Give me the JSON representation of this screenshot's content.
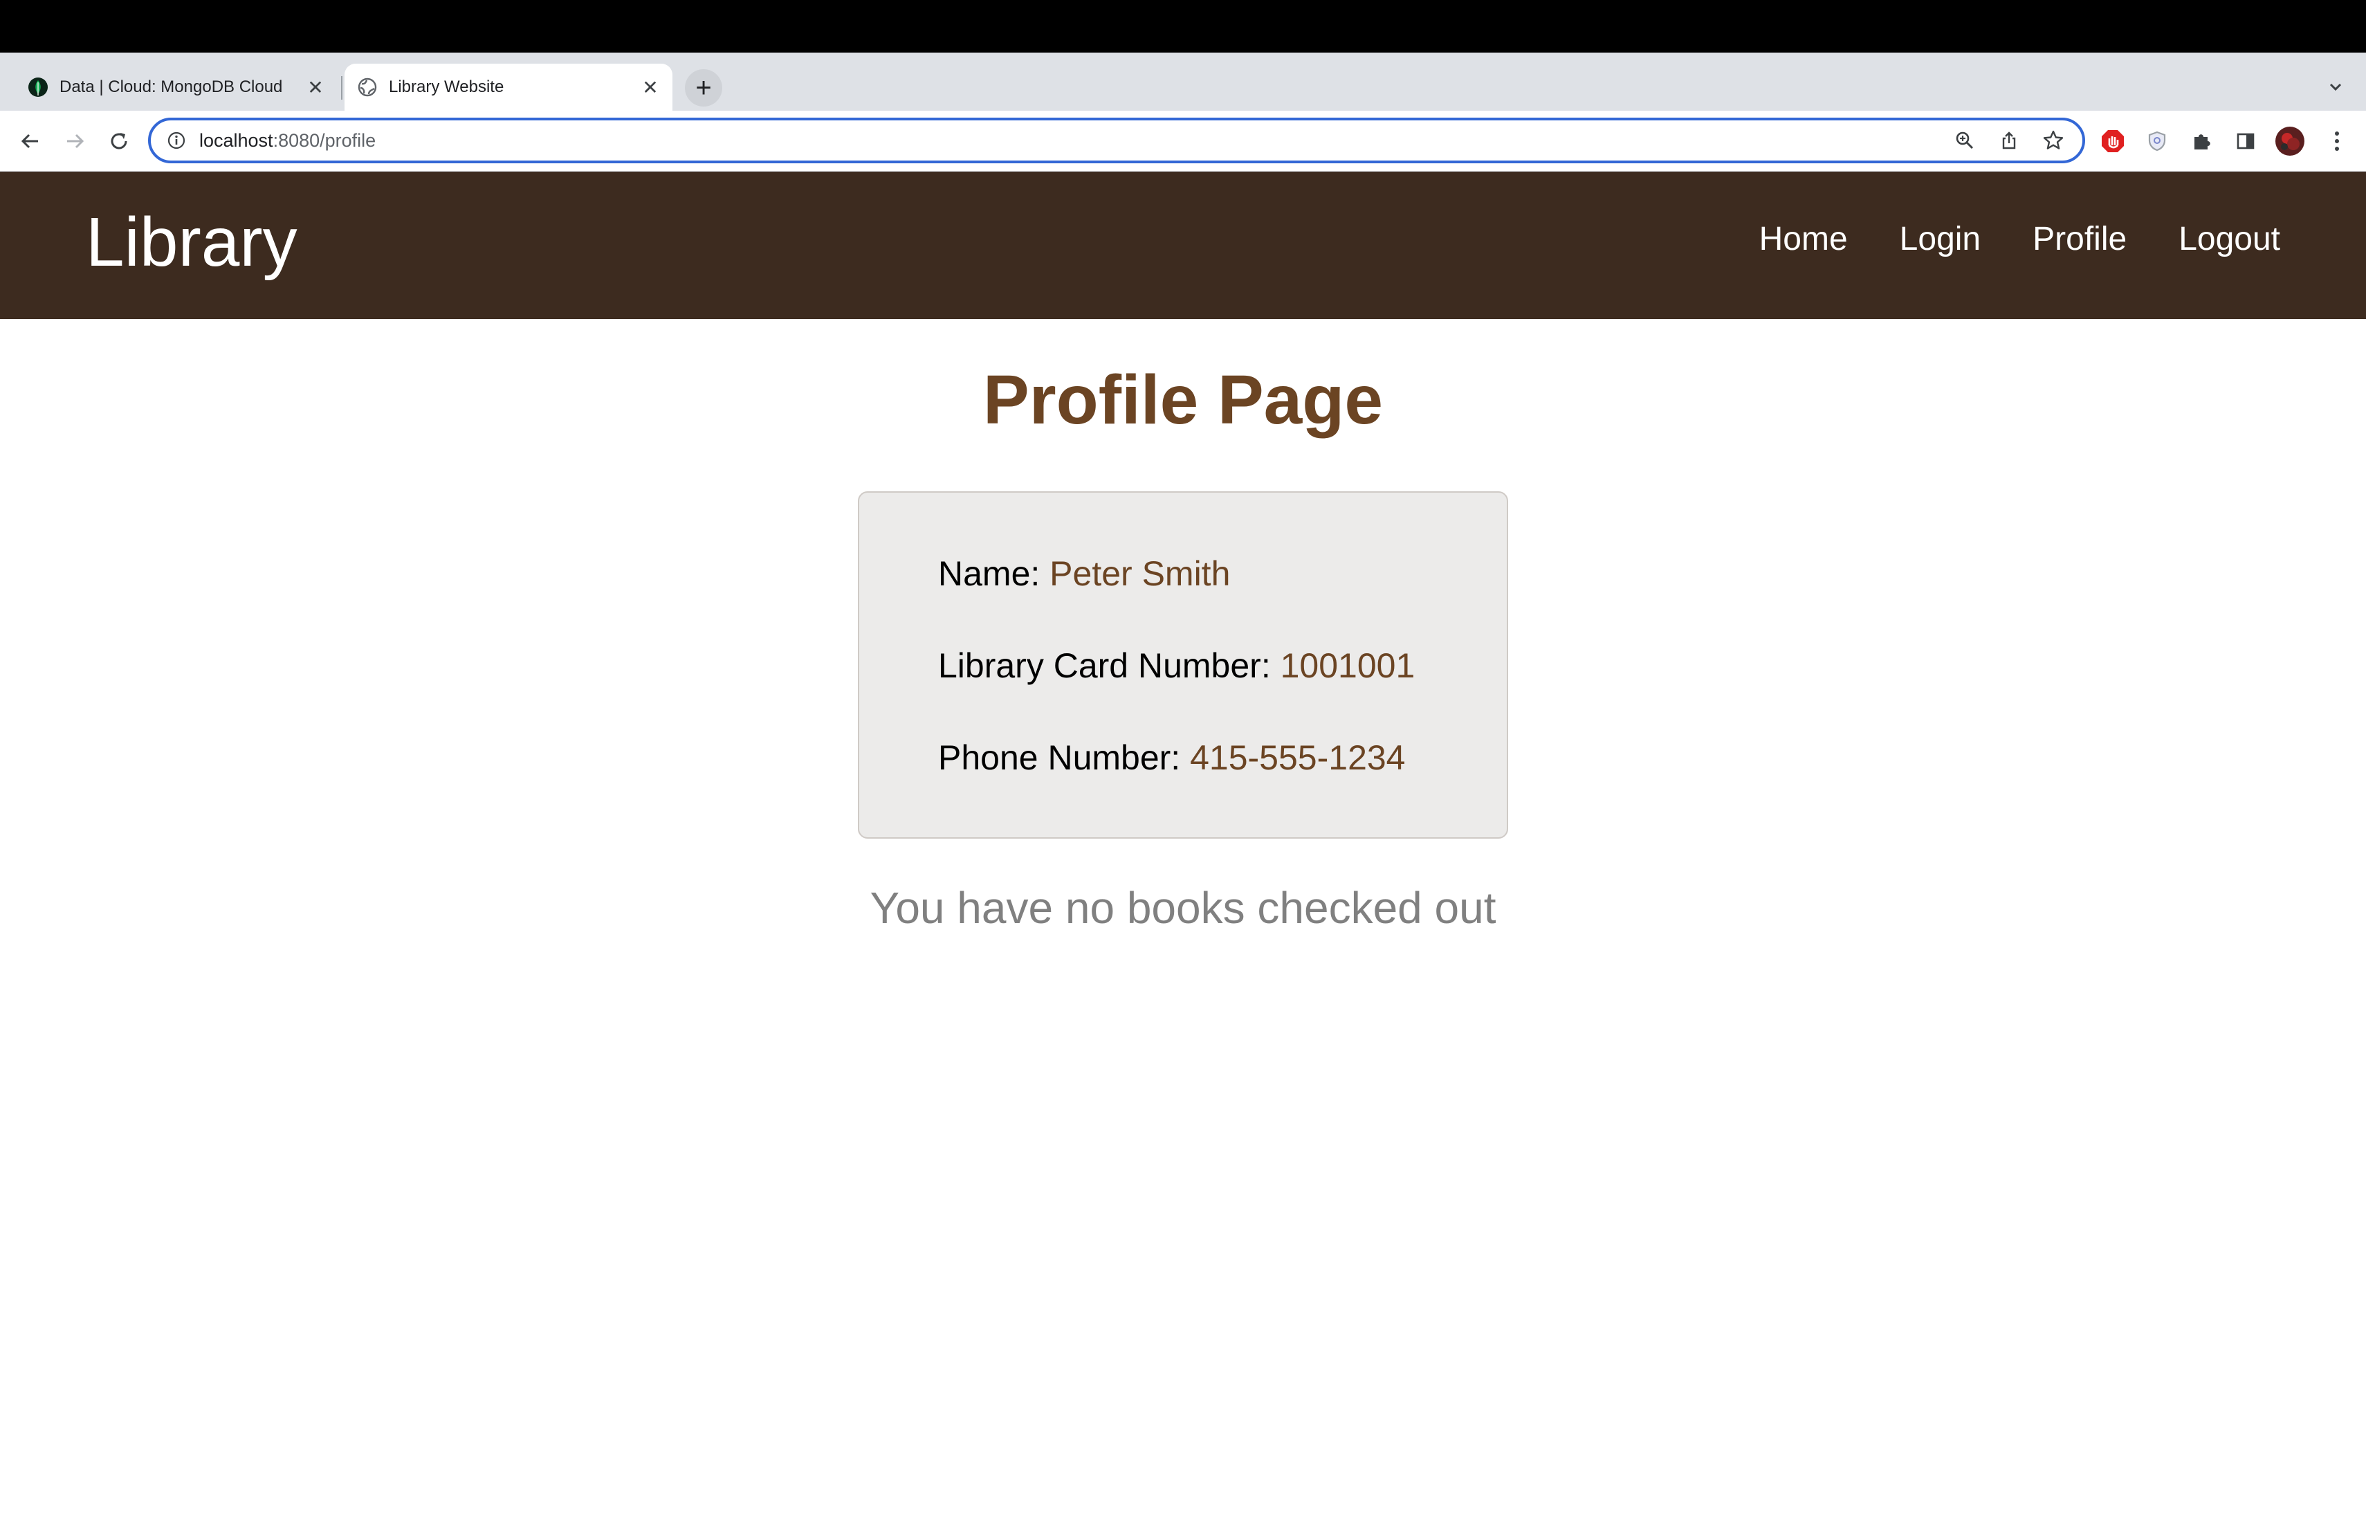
{
  "browser": {
    "tabs": [
      {
        "title": "Data | Cloud: MongoDB Cloud",
        "icon": "mongodb-leaf-icon",
        "active": false
      },
      {
        "title": "Library Website",
        "icon": "globe-icon",
        "active": true
      }
    ],
    "address": {
      "host": "localhost",
      "path": ":8080/profile"
    },
    "colors": {
      "omnibox_focus": "#3367d6"
    }
  },
  "site": {
    "brand": "Library",
    "nav": [
      "Home",
      "Login",
      "Profile",
      "Logout"
    ],
    "colors": {
      "header_bg": "#3d2b1f",
      "accent": "#6b4423",
      "card_bg": "#ecebea",
      "muted_text": "#808080"
    }
  },
  "profile": {
    "heading": "Profile Page",
    "name_label": "Name:",
    "name_value": "Peter Smith",
    "card_label": "Library Card Number:",
    "card_value": "1001001",
    "phone_label": "Phone Number:",
    "phone_value": "415-555-1234",
    "empty_message": "You have no books checked out"
  }
}
